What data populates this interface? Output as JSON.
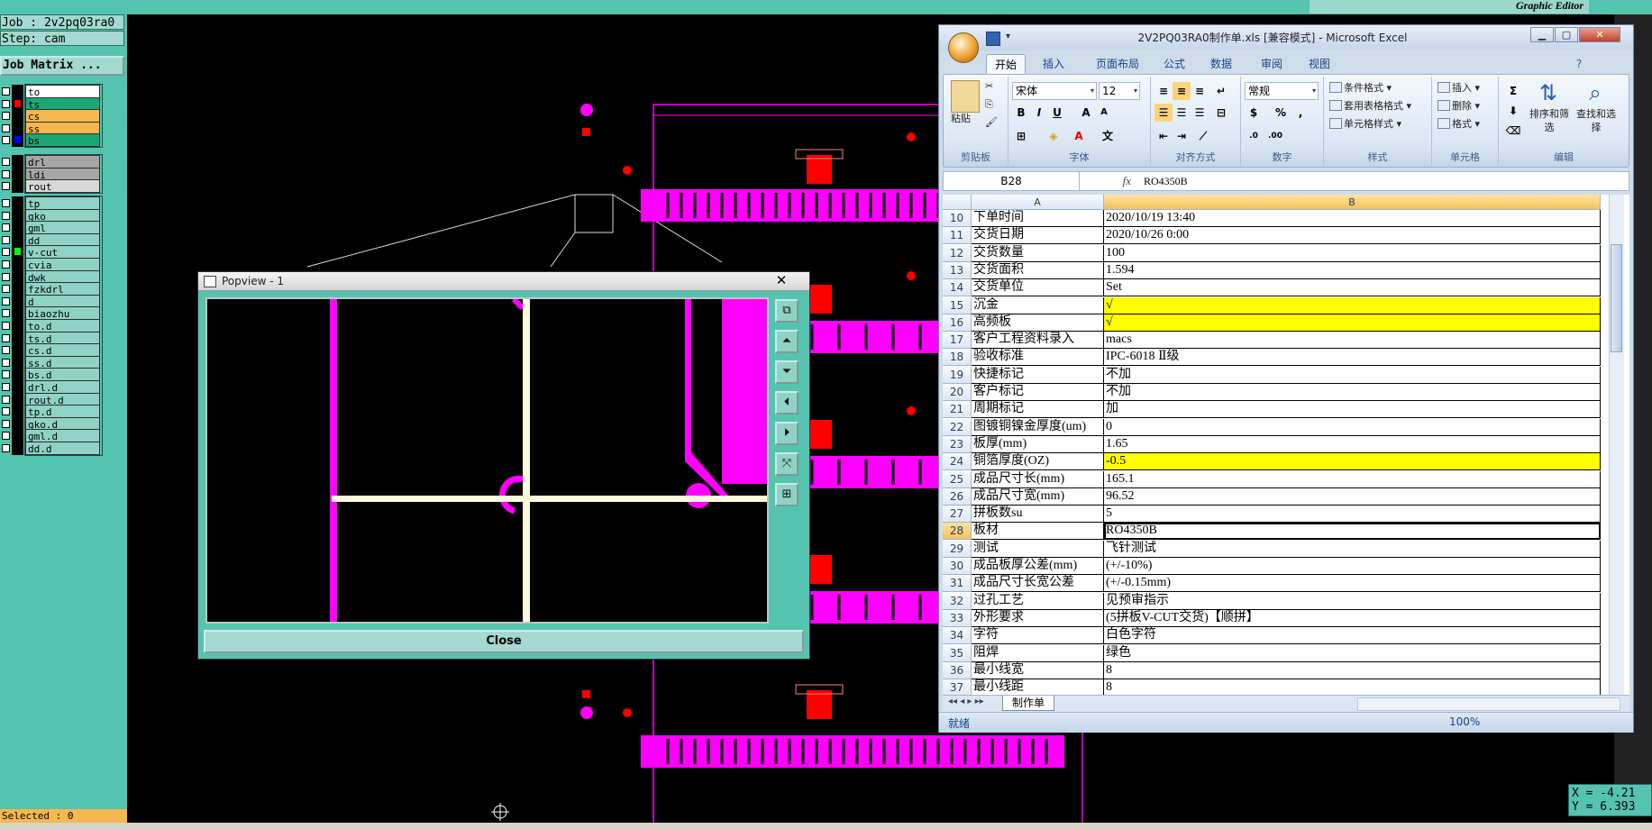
{
  "topbar": {
    "graphic_editor": "Graphic Editor"
  },
  "leftpanel": {
    "job": "Job : 2v2pq03ra0",
    "step": "Step: cam",
    "job_matrix": "Job Matrix ...",
    "layers": [
      {
        "name": "to",
        "bg": "#ffffff",
        "swatch": "#000000"
      },
      {
        "name": "ts",
        "bg": "#1aa774",
        "swatch": "#ff0000"
      },
      {
        "name": "cs",
        "bg": "#f5b84e",
        "swatch": "#000000"
      },
      {
        "name": "ss",
        "bg": "#f5b84e",
        "swatch": "#000000"
      },
      {
        "name": "bs",
        "bg": "#1aa774",
        "swatch": "#0000ff"
      },
      {
        "name": "drl",
        "bg": "#a6a6a6",
        "swatch": "#000000"
      },
      {
        "name": "ldi",
        "bg": "#a6a6a6",
        "swatch": "#000000"
      },
      {
        "name": "rout",
        "bg": "#d8d8d8",
        "swatch": "#000000"
      },
      {
        "name": "tp",
        "bg": "#8fd3c6",
        "swatch": "#000000"
      },
      {
        "name": "gko",
        "bg": "#8fd3c6",
        "swatch": "#000000"
      },
      {
        "name": "gml",
        "bg": "#8fd3c6",
        "swatch": "#000000"
      },
      {
        "name": "dd",
        "bg": "#8fd3c6",
        "swatch": "#000000"
      },
      {
        "name": "v-cut",
        "bg": "#8fd3c6",
        "swatch": "#00ff00"
      },
      {
        "name": "cvia",
        "bg": "#8fd3c6",
        "swatch": "#000000"
      },
      {
        "name": "dwk",
        "bg": "#8fd3c6",
        "swatch": "#000000"
      },
      {
        "name": "fzkdrl",
        "bg": "#8fd3c6",
        "swatch": "#000000"
      },
      {
        "name": "d",
        "bg": "#8fd3c6",
        "swatch": "#000000"
      },
      {
        "name": "biaozhu",
        "bg": "#8fd3c6",
        "swatch": "#000000"
      },
      {
        "name": "to.d",
        "bg": "#8fd3c6",
        "swatch": "#000000"
      },
      {
        "name": "ts.d",
        "bg": "#8fd3c6",
        "swatch": "#000000"
      },
      {
        "name": "cs.d",
        "bg": "#8fd3c6",
        "swatch": "#000000"
      },
      {
        "name": "ss.d",
        "bg": "#8fd3c6",
        "swatch": "#000000"
      },
      {
        "name": "bs.d",
        "bg": "#8fd3c6",
        "swatch": "#000000"
      },
      {
        "name": "drl.d",
        "bg": "#8fd3c6",
        "swatch": "#000000"
      },
      {
        "name": "rout.d",
        "bg": "#8fd3c6",
        "swatch": "#000000"
      },
      {
        "name": "tp.d",
        "bg": "#8fd3c6",
        "swatch": "#000000"
      },
      {
        "name": "gko.d",
        "bg": "#8fd3c6",
        "swatch": "#000000"
      },
      {
        "name": "gml.d",
        "bg": "#8fd3c6",
        "swatch": "#000000"
      },
      {
        "name": "dd.d",
        "bg": "#8fd3c6",
        "swatch": "#000000"
      }
    ],
    "selected": "Selected : 0"
  },
  "popview": {
    "title": "Popview - 1",
    "close_x": "✕",
    "close_label": "Close"
  },
  "excel": {
    "title": "2V2PQ03RA0制作单.xls [兼容模式] - Microsoft Excel",
    "tabs": [
      "开始",
      "插入",
      "页面布局",
      "公式",
      "数据",
      "审阅",
      "视图"
    ],
    "ribbon": {
      "paste": "粘贴",
      "font_name": "宋体",
      "font_size": "12",
      "number_format": "常规",
      "cond_format": "条件格式",
      "table_format": "套用表格格式",
      "cell_style": "单元格样式",
      "insert": "插入",
      "delete": "删除",
      "format": "格式",
      "sort_filter": "排序和筛选",
      "find_select": "查找和选择",
      "groups": [
        "剪贴板",
        "字体",
        "对齐方式",
        "数字",
        "样式",
        "单元格",
        "编辑"
      ]
    },
    "name_box": "B28",
    "fx": "fx",
    "formula_value": "RO4350B",
    "columns": [
      "A",
      "B"
    ],
    "rows": [
      {
        "n": "10",
        "a": "下单时间",
        "b": "2020/10/19 13:40",
        "hl": false
      },
      {
        "n": "11",
        "a": "交货日期",
        "b": "2020/10/26 0:00",
        "hl": false
      },
      {
        "n": "12",
        "a": "交货数量",
        "b": "100",
        "hl": false
      },
      {
        "n": "13",
        "a": "交货面积",
        "b": "1.594",
        "hl": false
      },
      {
        "n": "14",
        "a": "交货单位",
        "b": "Set",
        "hl": false
      },
      {
        "n": "15",
        "a": "沉金",
        "b": "√",
        "hl": true
      },
      {
        "n": "16",
        "a": "高频板",
        "b": "√",
        "hl": true
      },
      {
        "n": "17",
        "a": "客户工程资料录入",
        "b": "macs",
        "hl": false
      },
      {
        "n": "18",
        "a": "验收标准",
        "b": "IPC-6018 Ⅱ级",
        "hl": false
      },
      {
        "n": "19",
        "a": "快捷标记",
        "b": "不加",
        "hl": false
      },
      {
        "n": "20",
        "a": "客户标记",
        "b": "不加",
        "hl": false
      },
      {
        "n": "21",
        "a": "周期标记",
        "b": "加",
        "hl": false
      },
      {
        "n": "22",
        "a": "图镀铜镍金厚度(um)",
        "b": "0",
        "hl": false
      },
      {
        "n": "23",
        "a": "板厚(mm)",
        "b": "1.65",
        "hl": false
      },
      {
        "n": "24",
        "a": "铜箔厚度(OZ)",
        "b": "-0.5",
        "hl": true
      },
      {
        "n": "25",
        "a": "成品尺寸长(mm)",
        "b": "165.1",
        "hl": false
      },
      {
        "n": "26",
        "a": "成品尺寸宽(mm)",
        "b": "96.52",
        "hl": false
      },
      {
        "n": "27",
        "a": "拼板数su",
        "b": "5",
        "hl": false
      },
      {
        "n": "28",
        "a": "板材",
        "b": "RO4350B",
        "hl": false,
        "active": true
      },
      {
        "n": "29",
        "a": "测试",
        "b": "飞针测试",
        "hl": false
      },
      {
        "n": "30",
        "a": "成品板厚公差(mm)",
        "b": "(+/-10%)",
        "hl": false
      },
      {
        "n": "31",
        "a": "成品尺寸长宽公差",
        "b": "(+/-0.15mm)",
        "hl": false
      },
      {
        "n": "32",
        "a": "过孔工艺",
        "b": "见预审指示",
        "hl": false
      },
      {
        "n": "33",
        "a": "外形要求",
        "b": "(5拼板V-CUT交货)【顺拼】",
        "hl": false
      },
      {
        "n": "34",
        "a": "字符",
        "b": "白色字符",
        "hl": false
      },
      {
        "n": "35",
        "a": "阻焊",
        "b": "绿色",
        "hl": false
      },
      {
        "n": "36",
        "a": "最小线宽",
        "b": "8",
        "hl": false
      },
      {
        "n": "37",
        "a": "最小线距",
        "b": "8",
        "hl": false
      }
    ],
    "sheet_tab": "制作单",
    "status": "就绪",
    "zoom": "100%"
  },
  "coords": {
    "x": "X = -4.21",
    "y": "Y = 6.393"
  },
  "colors": {
    "magenta": "#ff00ff",
    "red": "#ff0000",
    "teal": "#54c4b0",
    "cream": "#fff8dc"
  }
}
